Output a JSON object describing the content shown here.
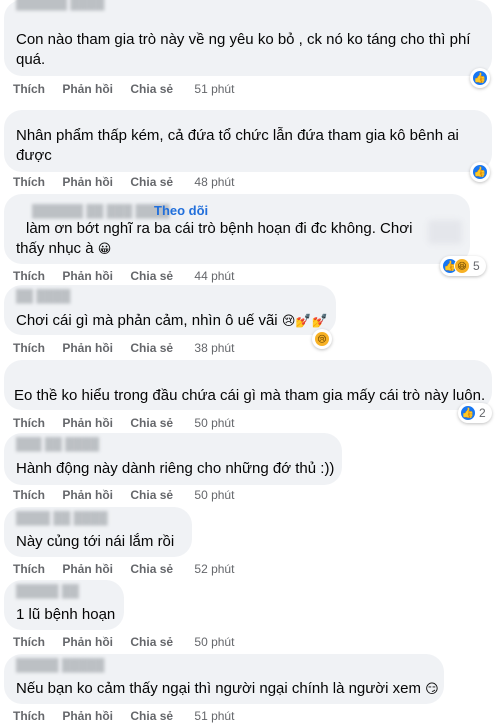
{
  "labels": {
    "like": "Thích",
    "reply": "Phản hồi",
    "share": "Chia sẻ",
    "follow": "Theo dõi"
  },
  "comments": [
    {
      "text1": "Con nào tham gia trò này về ng yêu ko bỏ , ck nó ko táng cho thì phí",
      "text2": "quá.",
      "time": "51 phút",
      "reactions": "like"
    },
    {
      "text1": "Nhân phẩm thấp kém, cả đứa tổ chức lẫn đứa tham gia kô bênh ai",
      "text2": "được",
      "time": "48 phút",
      "reactions": "like"
    },
    {
      "text1": "làm ơn bớt nghĩ ra ba cái trò bệnh hoạn đi đc không. Chơi",
      "text2": "thấy nhục à",
      "emoji2": "😀",
      "time": "44 phút",
      "reactions": "like-haha",
      "reaction_count": "5"
    },
    {
      "text1": "Chơi cái gì mà phản cảm, nhìn ô uế vãi",
      "emoji1": "😢💅💅",
      "time": "38 phút",
      "reactions": "sad"
    },
    {
      "text1": "Eo thề ko hiểu trong đầu chứa cái gì mà tham gia mấy cái trò này luôn.",
      "time": "50 phút",
      "reactions": "like",
      "reaction_count": "2"
    },
    {
      "text1": "Hành động này dành riêng cho những đớ thủ :))",
      "time": "50 phút"
    },
    {
      "text1": "Này củng tới nái lắm rồi",
      "time": "52 phút"
    },
    {
      "text1": "1 lũ bệnh hoạn",
      "time": "50 phút"
    },
    {
      "text1": "Nếu bạn ko cảm thấy ngại thì người ngại chính là người xem",
      "emoji1": "😏",
      "time": "51 phút"
    }
  ]
}
